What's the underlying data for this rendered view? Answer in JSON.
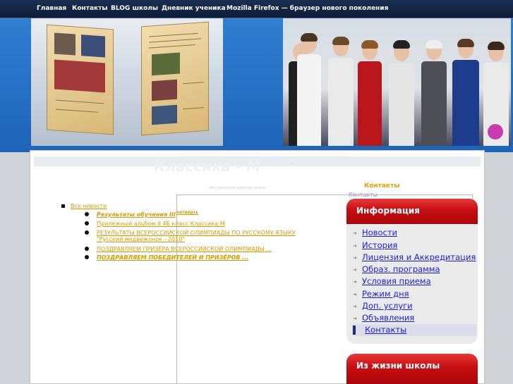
{
  "nav": {
    "home": "Главная",
    "contacts": "Контакты",
    "blog": "BLOG школы",
    "diary": "Дневник ученика",
    "firefox": "Mozilla Firefox — браузер нового поколения"
  },
  "site": {
    "title": "Классика - М",
    "subtitle": "...методическая копилка домой...",
    "dot": "."
  },
  "contacts_link": "Контакты",
  "contacts_small": "Контакты",
  "news": {
    "all": "Все новости",
    "items": [
      {
        "text": "Результаты обучения III",
        "sup": "четверть"
      },
      {
        "text": "Прилежный альбом II 4Б класс Классика-М"
      },
      {
        "text": "РЕЗУЛЬТАТЫ ВСЕРОССИЙСКОЙ ОЛИМПИАДЫ ПО РУССКОМУ ЯЗЫКУ",
        "line2": "\"Русский медвежонок - 2010\""
      },
      {
        "text": "ПОЗДРАВЛЯЕМ ПРИЗЁРА ВСЕРОССИЙСКОЙ ОЛИМПИАДЫ ..."
      },
      {
        "text": "ПОЗДРАВЛЯЕМ ПОБЕДИТЕЛЕЙ И ПРИЗЁРОВ ..."
      }
    ]
  },
  "sidebar": {
    "info_title": "Информация",
    "items": [
      {
        "label": "Новости"
      },
      {
        "label": "История"
      },
      {
        "label": "Лицензия и Аккредитация"
      },
      {
        "label": "Образ. программа"
      },
      {
        "label": "Условия приема"
      },
      {
        "label": "Режим дня"
      },
      {
        "label": "Доп. услуги"
      },
      {
        "label": "Объявления"
      },
      {
        "label": "Контакты",
        "active": true
      }
    ],
    "life_title": "Из жизни школы"
  },
  "icons": {
    "arrow": "arrow-right-icon",
    "square_bullet": "square-bullet-icon",
    "dot_bullet": "dot-bullet-icon"
  },
  "colors": {
    "nav_bg": "#0c1c36",
    "banner_blue": "#1e63b7",
    "link_gold": "#d19a00",
    "sidebar_red": "#c60e12",
    "sidebar_link": "#1b1be0"
  }
}
